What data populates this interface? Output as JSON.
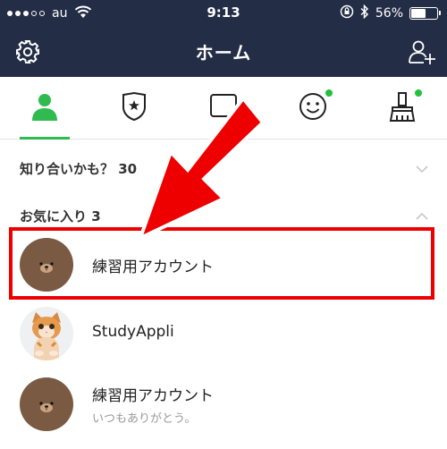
{
  "status_bar": {
    "carrier": "au",
    "time": "9:13",
    "battery_text": "56%",
    "battery_level": 0.56,
    "icons": [
      "signal-icon",
      "wifi-icon",
      "orientation-lock-icon",
      "bluetooth-icon",
      "battery-icon"
    ]
  },
  "header": {
    "title": "ホーム",
    "left_icon": "gear-icon",
    "right_icon": "add-friend-icon"
  },
  "tabs": [
    {
      "icon": "person-icon",
      "active": true,
      "badge": false
    },
    {
      "icon": "shield-star-icon",
      "active": false,
      "badge": false
    },
    {
      "icon": "chat-icon",
      "active": false,
      "badge": false
    },
    {
      "icon": "smiley-icon",
      "active": false,
      "badge": true
    },
    {
      "icon": "brush-icon",
      "active": false,
      "badge": true
    }
  ],
  "sections": {
    "suggested": {
      "title": "知り合いかも？ 30",
      "state": "collapsed"
    },
    "favorites": {
      "title": "お気に入り 3",
      "state": "expanded"
    }
  },
  "favorites": [
    {
      "name": "練習用アカウント",
      "status": "",
      "avatar": "bear-avatar"
    },
    {
      "name": "StudyAppli",
      "status": "",
      "avatar": "kitten-avatar"
    },
    {
      "name": "練習用アカウント",
      "status": "いつもありがとう。",
      "avatar": "bear-avatar"
    }
  ],
  "colors": {
    "header_bg": "#232d45",
    "accent_green": "#2fbb4f",
    "annotation_red": "#ee0000"
  }
}
